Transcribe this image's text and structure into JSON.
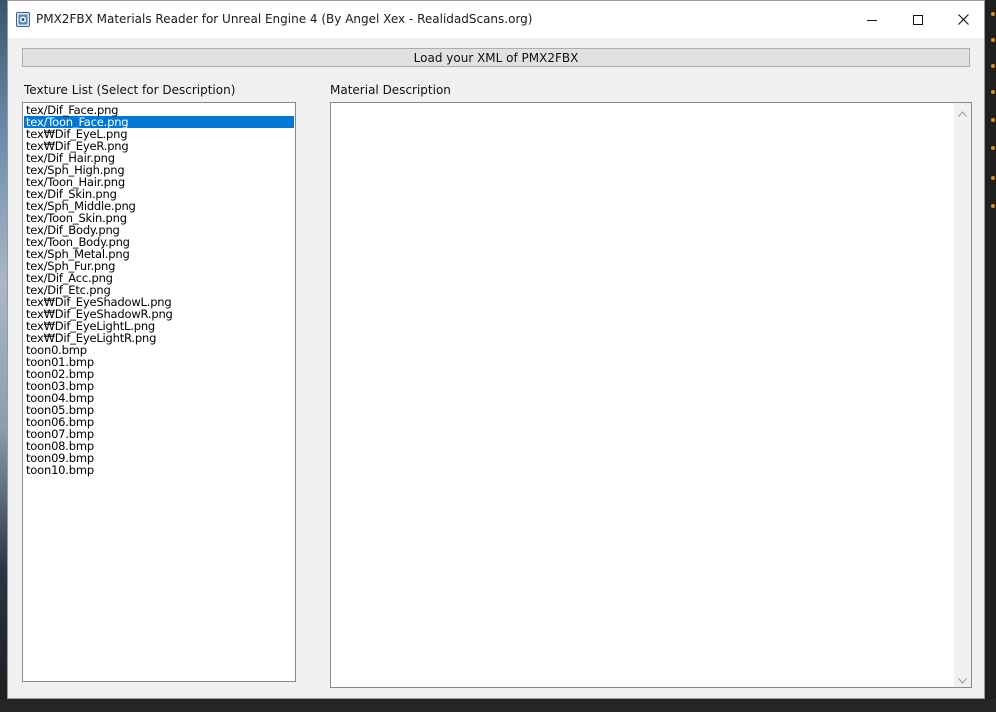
{
  "window": {
    "title": "PMX2FBX Materials Reader for Unreal Engine 4 (By Angel Xex - RealidadScans.org)"
  },
  "controls": {
    "minimize_icon": "minimize-icon",
    "maximize_icon": "maximize-icon",
    "close_icon": "close-icon"
  },
  "load_button": {
    "label": "Load your XML of PMX2FBX"
  },
  "texture_list": {
    "label": "Texture List (Select for Description)",
    "selected_index": 1,
    "items": [
      "tex/Dif_Face.png",
      "tex/Toon_Face.png",
      "tex₩Dif_EyeL.png",
      "tex₩Dif_EyeR.png",
      "tex/Dif_Hair.png",
      "tex/Sph_High.png",
      "tex/Toon_Hair.png",
      "tex/Dif_Skin.png",
      "tex/Sph_Middle.png",
      "tex/Toon_Skin.png",
      "tex/Dif_Body.png",
      "tex/Toon_Body.png",
      "tex/Sph_Metal.png",
      "tex/Sph_Fur.png",
      "tex/Dif_Acc.png",
      "tex/Dif_Etc.png",
      "tex₩Dif_EyeShadowL.png",
      "tex₩Dif_EyeShadowR.png",
      "tex₩Dif_EyeLightL.png",
      "tex₩Dif_EyeLightR.png",
      "toon0.bmp",
      "toon01.bmp",
      "toon02.bmp",
      "toon03.bmp",
      "toon04.bmp",
      "toon05.bmp",
      "toon06.bmp",
      "toon07.bmp",
      "toon08.bmp",
      "toon09.bmp",
      "toon10.bmp"
    ]
  },
  "material_description": {
    "label": "Material Description",
    "value": ""
  },
  "colors": {
    "selection": "#0078d7",
    "window_bg": "#f0f0f0"
  }
}
